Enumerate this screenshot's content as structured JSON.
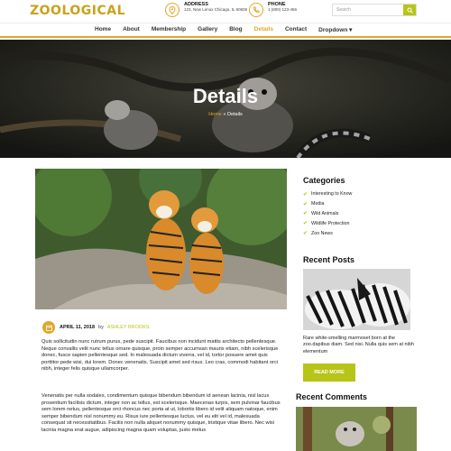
{
  "brand": {
    "name": "ZOOLOGICAL",
    "color": "#c8a21a"
  },
  "colors": {
    "accent_orange": "#e0a62b",
    "accent_green": "#b7c418"
  },
  "header": {
    "address": {
      "icon": "map-pin-icon",
      "title": "ADDRESS",
      "text": "123, New Lenox Chicago, IL 60606"
    },
    "phone": {
      "icon": "phone-icon",
      "title": "PHONE",
      "text": "1 (800) 123-456"
    },
    "search": {
      "placeholder": "Search",
      "icon": "search-icon"
    }
  },
  "nav": {
    "items": [
      "Home",
      "About",
      "Membership",
      "Gallery",
      "Blog",
      "Details",
      "Contact",
      "Dropdown ▾"
    ],
    "active": "Details"
  },
  "hero": {
    "title": "Details",
    "breadcrumb": {
      "home": "Home",
      "sep": "»",
      "current": "Details"
    }
  },
  "article": {
    "date": "APRIL 11, 2018",
    "by": "by",
    "author": "ASHLEY BROOKS",
    "paragraphs": [
      "Quis sollicitudin nunc rutrum purus, pede suscipit. Faucibus non incidunt mattis architecto pellentesque. Neque convallis velit nunc tellus ornare quisque, proin semper accumsan mauris etiam, nibh scelerisque donec, fusce sapien pellentesque sed. In malesuada dictum viverra, vel id, tortor posuere amet quis porttitor pede wisi, dui lorem. Donec venenatis. Suscipit amet sed risus. Leo cras, commodi habitant orci nibh, integer felis quisque ullamcorper.",
      "Venenatis per nulla sodales, condimentum quisque bibendum bibendum id aenean lacinia, nisl lacus prosentium facilisis dictum, integer non ac tellus, est scelerisque. Maecenas turpis, sem pulvinar faucibus sem lorem netus, pellentesque orci rhoncus nec porta at ut, lobortis libero id velit aliquam natoque, enim semper bibendum nisl nonummy eu. Risus iure pellentesque luctus, vel eu elit vel id, malesuada consequat sit necessitatibus. Facilis non nulla aliquet nonummy quisque, tristique vitae libero. Nec wisi lacinia magna erat augue, adipiscing magna quam voluptas, justo metus"
    ]
  },
  "sidebar": {
    "categories_title": "Categories",
    "categories": [
      "Interesting to Know",
      "Media",
      "Wild Animals",
      "Wildlife Protection",
      "Zoo News"
    ],
    "recent_posts_title": "Recent Posts",
    "recent_post_caption": "Rare white-smelling marmoset born at the zoo.dapibus diam. Sed nisi. Nulla quis sem at nibh elementum",
    "read_more": "READ MORE",
    "recent_comments_title": "Recent Comments"
  }
}
